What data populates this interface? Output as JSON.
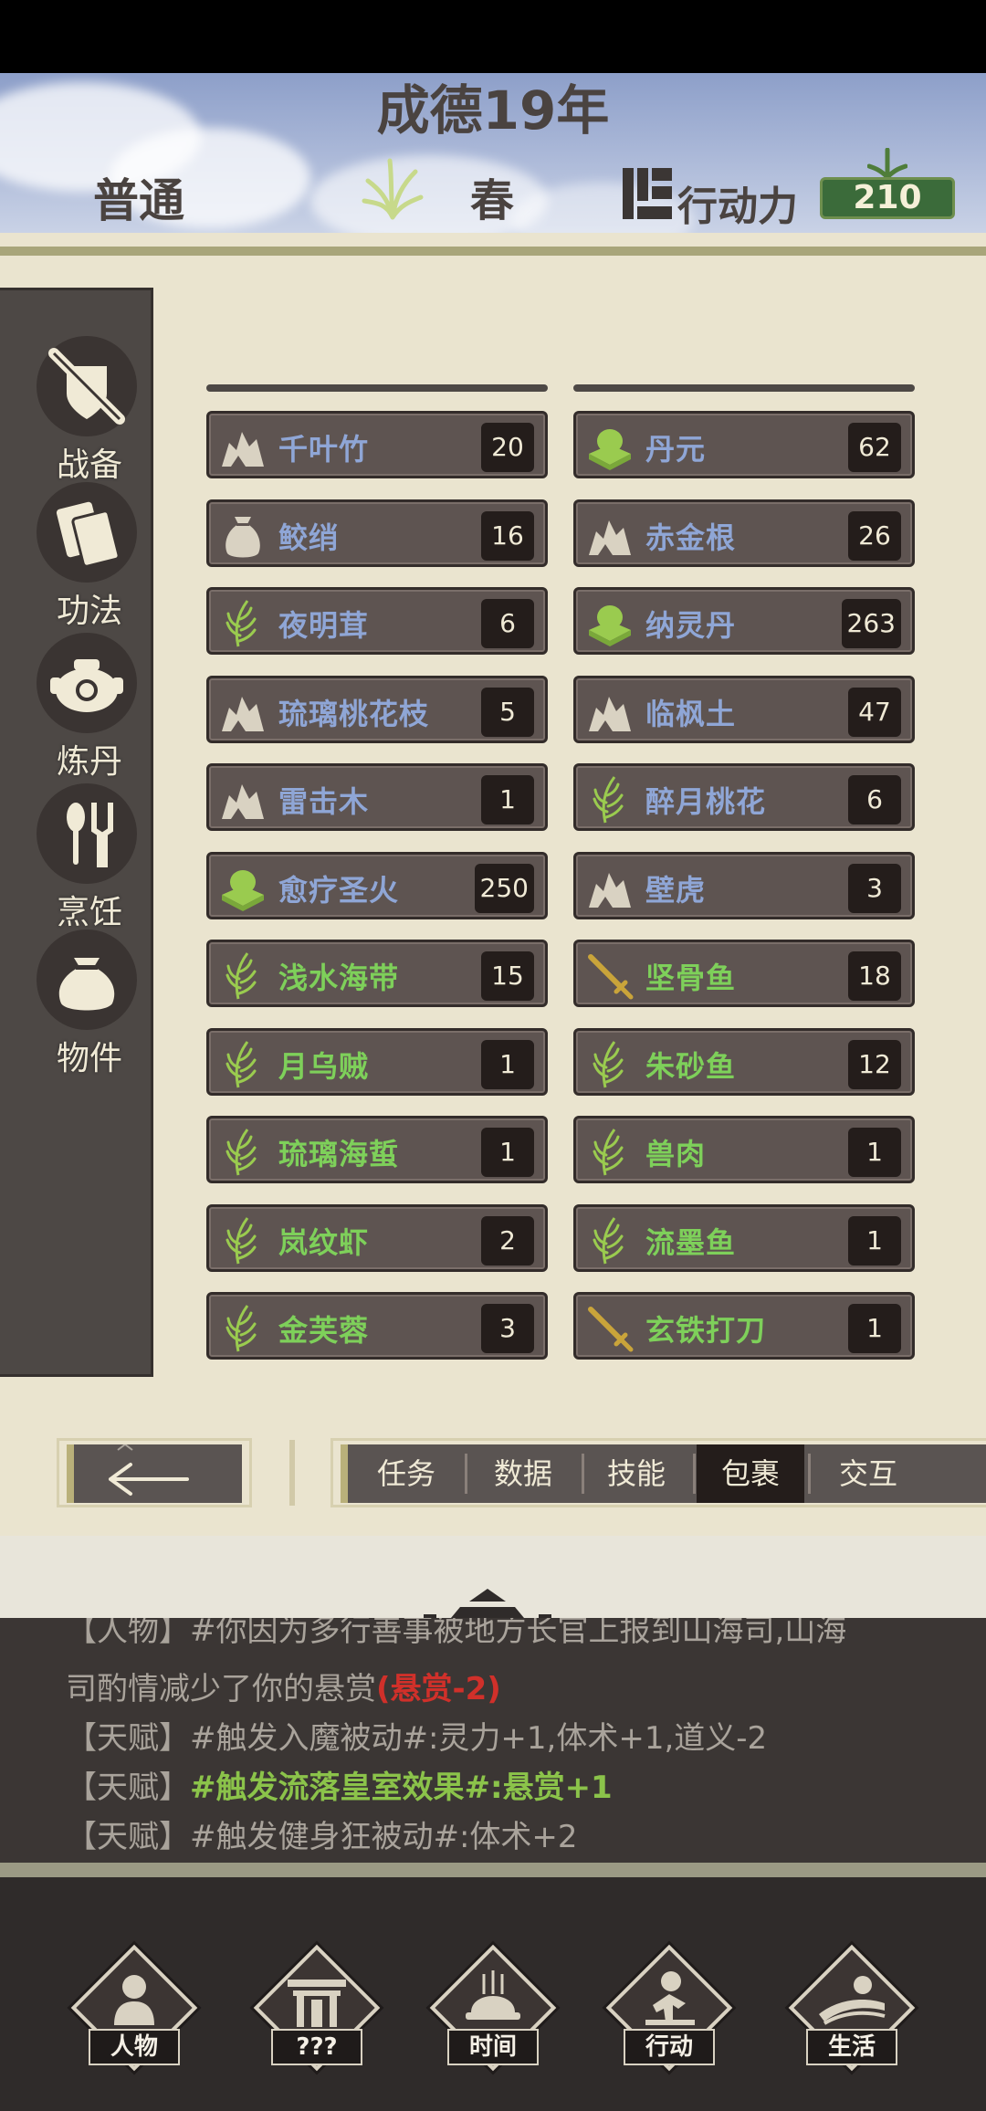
{
  "header": {
    "year": "成德19年",
    "difficulty": "普通",
    "season": "春",
    "action_points_label": "行动力",
    "action_points_value": "210"
  },
  "sidebar": {
    "items": [
      {
        "label": "战备",
        "icon": "shield-sword-icon"
      },
      {
        "label": "功法",
        "icon": "book-icon"
      },
      {
        "label": "炼丹",
        "icon": "cauldron-icon"
      },
      {
        "label": "烹饪",
        "icon": "utensils-icon"
      },
      {
        "label": "物件",
        "icon": "pouch-icon"
      }
    ]
  },
  "inventory": {
    "left": [
      {
        "name": "千叶竹",
        "count": "20",
        "icon": "ore-icon",
        "color": "blue"
      },
      {
        "name": "鲛绡",
        "count": "16",
        "icon": "sack-icon",
        "color": "blue"
      },
      {
        "name": "夜明茸",
        "count": "6",
        "icon": "grass-icon",
        "color": "blue"
      },
      {
        "name": "琉璃桃花枝",
        "count": "5",
        "icon": "ore-icon",
        "color": "blue"
      },
      {
        "name": "雷击木",
        "count": "1",
        "icon": "ore-icon",
        "color": "blue"
      },
      {
        "name": "愈疗圣火",
        "count": "250",
        "icon": "pill-icon",
        "color": "blue"
      },
      {
        "name": "浅水海带",
        "count": "15",
        "icon": "grass-icon",
        "color": "green"
      },
      {
        "name": "月乌贼",
        "count": "1",
        "icon": "grass-icon",
        "color": "green"
      },
      {
        "name": "琉璃海蜇",
        "count": "1",
        "icon": "grass-icon",
        "color": "green"
      },
      {
        "name": "岚纹虾",
        "count": "2",
        "icon": "grass-icon",
        "color": "green"
      },
      {
        "name": "金芙蓉",
        "count": "3",
        "icon": "grass-icon",
        "color": "green"
      }
    ],
    "right": [
      {
        "name": "丹元",
        "count": "62",
        "icon": "pill-icon",
        "color": "blue"
      },
      {
        "name": "赤金根",
        "count": "26",
        "icon": "ore-icon",
        "color": "blue"
      },
      {
        "name": "纳灵丹",
        "count": "263",
        "icon": "pill-icon",
        "color": "blue"
      },
      {
        "name": "临枫土",
        "count": "47",
        "icon": "ore-icon",
        "color": "blue"
      },
      {
        "name": "醉月桃花",
        "count": "6",
        "icon": "grass-icon",
        "color": "blue"
      },
      {
        "name": "壁虎",
        "count": "3",
        "icon": "ore-icon",
        "color": "blue"
      },
      {
        "name": "坚骨鱼",
        "count": "18",
        "icon": "sword-icon",
        "color": "green"
      },
      {
        "name": "朱砂鱼",
        "count": "12",
        "icon": "grass-icon",
        "color": "green"
      },
      {
        "name": "兽肉",
        "count": "1",
        "icon": "grass-icon",
        "color": "green"
      },
      {
        "name": "流墨鱼",
        "count": "1",
        "icon": "grass-icon",
        "color": "green"
      },
      {
        "name": "玄铁打刀",
        "count": "1",
        "icon": "sword-icon",
        "color": "green"
      }
    ]
  },
  "tabs": [
    "任务",
    "数据",
    "技能",
    "包裹",
    "交互"
  ],
  "active_tab": "包裹",
  "log": {
    "line0": "【人物】#你因为多行善事被地方长官上报到山海司,山海",
    "line1_text": "司酌情减少了你的悬赏",
    "line1_highlight": "(悬赏-2)",
    "line2": "【天赋】#触发入魔被动#:灵力+1,体术+1,道义-2",
    "line3_prefix": "【天赋】",
    "line3_highlight": "#触发流落皇室效果#:悬赏+1",
    "line4": "【天赋】#触发健身狂被动#:体术+2"
  },
  "bottom_nav": [
    {
      "label": "人物",
      "icon": "person-icon"
    },
    {
      "label": "???",
      "icon": "gate-icon"
    },
    {
      "label": "时间",
      "icon": "incense-icon"
    },
    {
      "label": "行动",
      "icon": "action-icon"
    },
    {
      "label": "生活",
      "icon": "field-icon"
    }
  ],
  "colors": {
    "name_blue": "#8fa6d6",
    "name_green": "#7ed05a",
    "icon_gold": "#c9a43a",
    "icon_green": "#9acb4f"
  }
}
